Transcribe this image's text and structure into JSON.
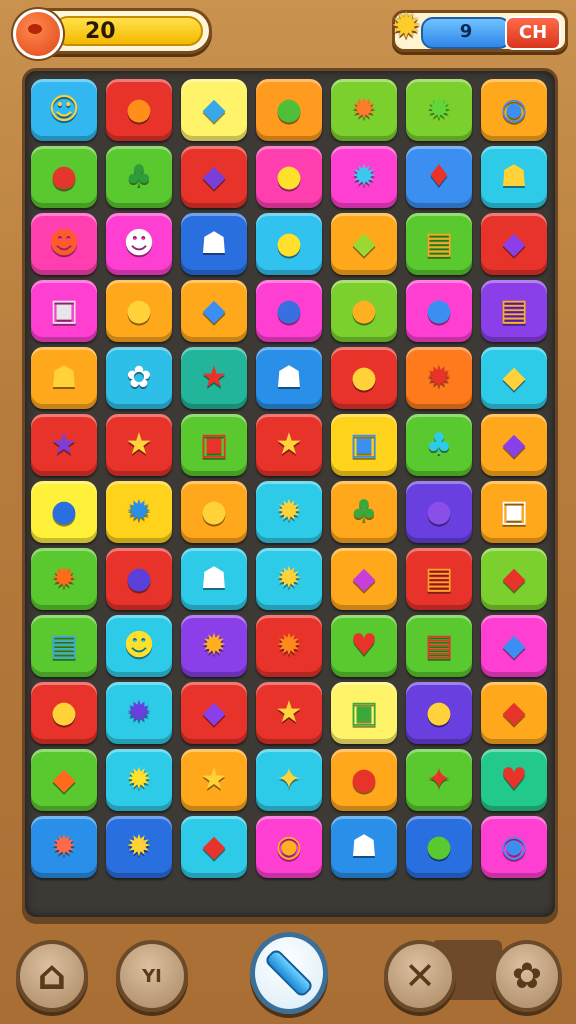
{
  "hud": {
    "score_value": "20",
    "star_value": "9",
    "right_button_label": "CH"
  },
  "board": {
    "rows": [
      [
        {
          "bg": "#32b7f0",
          "icon": "☺",
          "color": "#ffd23a"
        },
        {
          "bg": "#e8332b",
          "icon": "●",
          "color": "#ff8f1a"
        },
        {
          "bg": "#fff36a",
          "icon": "◆",
          "color": "#3aa8e8"
        },
        {
          "bg": "#ff9b1e",
          "icon": "●",
          "color": "#4fbf3a"
        },
        {
          "bg": "#7bd02e",
          "icon": "✹",
          "color": "#ff7a2a"
        },
        {
          "bg": "#7bd02e",
          "icon": "✹",
          "color": "#5fd63a"
        },
        {
          "bg": "#ffa81c",
          "icon": "◉",
          "color": "#3a8ff0"
        }
      ],
      [
        {
          "bg": "#5ac92f",
          "icon": "●",
          "color": "#e2372a"
        },
        {
          "bg": "#5ac92f",
          "icon": "♣",
          "color": "#2e9c3a"
        },
        {
          "bg": "#e8332b",
          "icon": "◆",
          "color": "#7a3fd8"
        },
        {
          "bg": "#ff3fb0",
          "icon": "●",
          "color": "#ffe02a"
        },
        {
          "bg": "#ff3fd2",
          "icon": "✹",
          "color": "#3ec8f0"
        },
        {
          "bg": "#3a8ff0",
          "icon": "♦",
          "color": "#e8332b"
        },
        {
          "bg": "#2ecbe8",
          "icon": "☗",
          "color": "#ffd23a"
        }
      ],
      [
        {
          "bg": "#ff3fb0",
          "icon": "☻",
          "color": "#ff5a2a"
        },
        {
          "bg": "#ff3fd2",
          "icon": "☻",
          "color": "#ffffff"
        },
        {
          "bg": "#2a6fe0",
          "icon": "☗",
          "color": "#ffffff"
        },
        {
          "bg": "#32c2f0",
          "icon": "●",
          "color": "#ffe02a"
        },
        {
          "bg": "#ffa81c",
          "icon": "◆",
          "color": "#9ad832"
        },
        {
          "bg": "#5ac92f",
          "icon": "▤",
          "color": "#ffa22a"
        },
        {
          "bg": "#e8332b",
          "icon": "◆",
          "color": "#8a3fe8"
        }
      ],
      [
        {
          "bg": "#ff3fd2",
          "icon": "▣",
          "color": "#e6e6e6"
        },
        {
          "bg": "#ffa81c",
          "icon": "●",
          "color": "#ffd23a"
        },
        {
          "bg": "#ffa81c",
          "icon": "◆",
          "color": "#3a8ff0"
        },
        {
          "bg": "#ff3fd2",
          "icon": "●",
          "color": "#3a6fe0"
        },
        {
          "bg": "#7bd02e",
          "icon": "●",
          "color": "#ffb020"
        },
        {
          "bg": "#ff3fd2",
          "icon": "●",
          "color": "#3a8ff0"
        },
        {
          "bg": "#8a3fe8",
          "icon": "▤",
          "color": "#ffb020"
        }
      ],
      [
        {
          "bg": "#ffa81c",
          "icon": "☗",
          "color": "#ffd23a"
        },
        {
          "bg": "#2ebfe8",
          "icon": "✿",
          "color": "#ffffff"
        },
        {
          "bg": "#22b59b",
          "icon": "★",
          "color": "#e8332b"
        },
        {
          "bg": "#2a8fe8",
          "icon": "☗",
          "color": "#ffffff"
        },
        {
          "bg": "#e8332b",
          "icon": "●",
          "color": "#ffd23a"
        },
        {
          "bg": "#ff7a1c",
          "icon": "✹",
          "color": "#e8332b"
        },
        {
          "bg": "#2ecbe8",
          "icon": "◆",
          "color": "#ffd23a"
        }
      ],
      [
        {
          "bg": "#e8332b",
          "icon": "★",
          "color": "#7a3fd8"
        },
        {
          "bg": "#e8332b",
          "icon": "★",
          "color": "#ffd23a"
        },
        {
          "bg": "#5ac92f",
          "icon": "▣",
          "color": "#e8332b"
        },
        {
          "bg": "#e8332b",
          "icon": "★",
          "color": "#ffd23a"
        },
        {
          "bg": "#ffd21c",
          "icon": "▣",
          "color": "#3a8ff0"
        },
        {
          "bg": "#5ac92f",
          "icon": "♣",
          "color": "#2ecbe8"
        },
        {
          "bg": "#ffa81c",
          "icon": "◆",
          "color": "#8a3fe8"
        }
      ],
      [
        {
          "bg": "#fff03a",
          "icon": "●",
          "color": "#2a6fe0"
        },
        {
          "bg": "#ffd21c",
          "icon": "✹",
          "color": "#2a8fe8"
        },
        {
          "bg": "#ffa81c",
          "icon": "●",
          "color": "#ffd23a"
        },
        {
          "bg": "#2ecbe8",
          "icon": "✹",
          "color": "#ffd23a"
        },
        {
          "bg": "#ffa81c",
          "icon": "♣",
          "color": "#3aa83a"
        },
        {
          "bg": "#6a3fe0",
          "icon": "●",
          "color": "#8a4fe8"
        },
        {
          "bg": "#ffa81c",
          "icon": "▣",
          "color": "#ffffff"
        }
      ],
      [
        {
          "bg": "#5ac92f",
          "icon": "✹",
          "color": "#ff6a1c"
        },
        {
          "bg": "#e8332b",
          "icon": "●",
          "color": "#5a3fd8"
        },
        {
          "bg": "#2ecbe8",
          "icon": "☗",
          "color": "#ffffff"
        },
        {
          "bg": "#2ecbe8",
          "icon": "✹",
          "color": "#ffd23a"
        },
        {
          "bg": "#ffa81c",
          "icon": "◆",
          "color": "#c83fd8"
        },
        {
          "bg": "#e8332b",
          "icon": "▤",
          "color": "#ffa22a"
        },
        {
          "bg": "#7bd02e",
          "icon": "◆",
          "color": "#e8332b"
        }
      ],
      [
        {
          "bg": "#5ac92f",
          "icon": "▤",
          "color": "#3aa8e8"
        },
        {
          "bg": "#2ecbe8",
          "icon": "☻",
          "color": "#ffe02a"
        },
        {
          "bg": "#8a3fe8",
          "icon": "✹",
          "color": "#ffb020"
        },
        {
          "bg": "#e8332b",
          "icon": "✹",
          "color": "#ff8a1c"
        },
        {
          "bg": "#5ac92f",
          "icon": "♥",
          "color": "#e8332b"
        },
        {
          "bg": "#5ac92f",
          "icon": "▤",
          "color": "#e8332b"
        },
        {
          "bg": "#ff3fd2",
          "icon": "◆",
          "color": "#3a8ff0"
        }
      ],
      [
        {
          "bg": "#e8332b",
          "icon": "●",
          "color": "#ffd23a"
        },
        {
          "bg": "#2ecbe8",
          "icon": "✹",
          "color": "#6a3fe0"
        },
        {
          "bg": "#e8332b",
          "icon": "◆",
          "color": "#8a3fe8"
        },
        {
          "bg": "#e8332b",
          "icon": "★",
          "color": "#ffd23a"
        },
        {
          "bg": "#fff36a",
          "icon": "▣",
          "color": "#3aa83a"
        },
        {
          "bg": "#6a3fe0",
          "icon": "●",
          "color": "#ffd23a"
        },
        {
          "bg": "#ffa81c",
          "icon": "◆",
          "color": "#e8332b"
        }
      ],
      [
        {
          "bg": "#5ac92f",
          "icon": "◆",
          "color": "#ff6a1c"
        },
        {
          "bg": "#2ecbe8",
          "icon": "✹",
          "color": "#ffe02a"
        },
        {
          "bg": "#ffa81c",
          "icon": "★",
          "color": "#ffd23a"
        },
        {
          "bg": "#2ecbe8",
          "icon": "✦",
          "color": "#ffd23a"
        },
        {
          "bg": "#ffa81c",
          "icon": "●",
          "color": "#e8332b"
        },
        {
          "bg": "#5ac92f",
          "icon": "✦",
          "color": "#e8332b"
        },
        {
          "bg": "#22c98a",
          "icon": "♥",
          "color": "#e8332b"
        }
      ],
      [
        {
          "bg": "#2a8fe8",
          "icon": "✹",
          "color": "#ff6a4a"
        },
        {
          "bg": "#2a6fe0",
          "icon": "✹",
          "color": "#ffd23a"
        },
        {
          "bg": "#2ecbe8",
          "icon": "◆",
          "color": "#e8332b"
        },
        {
          "bg": "#ff3fd2",
          "icon": "◉",
          "color": "#ffb020"
        },
        {
          "bg": "#2a8fe8",
          "icon": "☗",
          "color": "#ffffff"
        },
        {
          "bg": "#2a6fe0",
          "icon": "●",
          "color": "#5ac92f"
        },
        {
          "bg": "#ff3fd2",
          "icon": "◉",
          "color": "#3a8ff0"
        }
      ]
    ]
  },
  "toolbar": {
    "home_icon": "⌂",
    "shop_label": "YI",
    "center_icon": "slash-icon",
    "swap_icon": "✕",
    "pet_icon": "✿"
  }
}
